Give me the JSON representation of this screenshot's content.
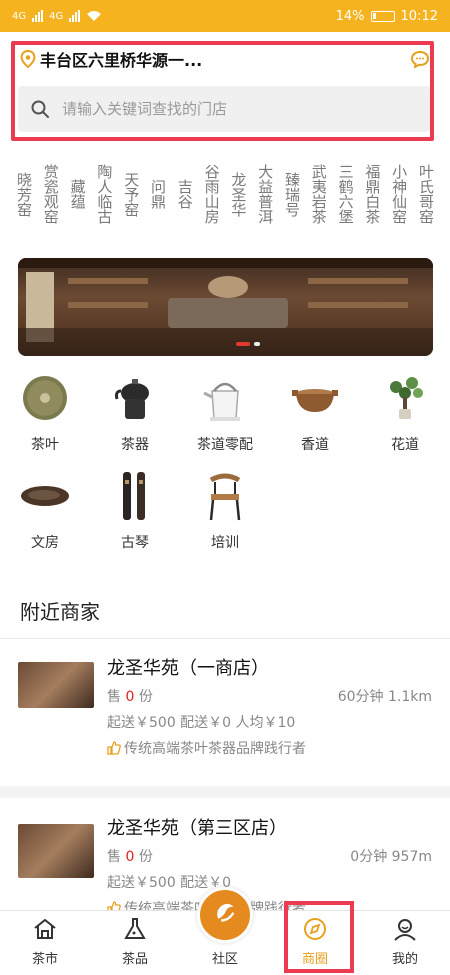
{
  "status_bar": {
    "network": "4G",
    "network2": "4G",
    "battery": "14%",
    "time": "10:12"
  },
  "header": {
    "location": "丰台区六里桥华源一...",
    "search_placeholder": "请输入关键词查找的门店"
  },
  "shops_vertical": [
    "晓芳窑",
    "赏瓷观窑",
    "藏蕴",
    "陶人临古",
    "天予窑",
    "问鼎",
    "吉谷",
    "谷雨山房",
    "龙圣华",
    "大益普洱",
    "臻瑞号",
    "武夷岩茶",
    "三鹤六堡",
    "福鼎白茶",
    "小神仙窑",
    "叶氏哥窑"
  ],
  "categories": [
    {
      "label": "茶叶",
      "icon": "tea-cake-icon"
    },
    {
      "label": "茶器",
      "icon": "teapot-icon"
    },
    {
      "label": "茶道零配",
      "icon": "kettle-icon"
    },
    {
      "label": "香道",
      "icon": "incense-burner-icon"
    },
    {
      "label": "花道",
      "icon": "flower-icon"
    },
    {
      "label": "文房",
      "icon": "inkstone-icon"
    },
    {
      "label": "古琴",
      "icon": "guqin-icon"
    },
    {
      "label": "培训",
      "icon": "chair-icon"
    }
  ],
  "nearby": {
    "title": "附近商家",
    "shops": [
      {
        "name": "龙圣华苑（一商店）",
        "sold_prefix": "售",
        "sold_count": "0",
        "sold_suffix": "份",
        "distance": "60分钟 1.1km",
        "fees": "起送￥500 配送￥0 人均￥10",
        "tag": "传统高端茶叶茶器品牌践行者"
      },
      {
        "name": "龙圣华苑（第三区店）",
        "sold_prefix": "售",
        "sold_count": "0",
        "sold_suffix": "份",
        "distance": "0分钟 957m",
        "fees": "起送￥500 配送￥0",
        "tag": "传统高端茶叶茶器品牌践行者"
      }
    ]
  },
  "bottom_nav": [
    {
      "label": "茶市",
      "icon": "home-icon"
    },
    {
      "label": "茶品",
      "icon": "flask-icon"
    },
    {
      "label": "社区",
      "icon": "community-icon"
    },
    {
      "label": "商圈",
      "icon": "compass-icon",
      "active": true
    },
    {
      "label": "我的",
      "icon": "user-icon"
    }
  ],
  "colors": {
    "accent": "#f4b31f",
    "highlight": "#ec3b50",
    "price_red": "#e02020",
    "active_nav": "#e6a11f"
  }
}
